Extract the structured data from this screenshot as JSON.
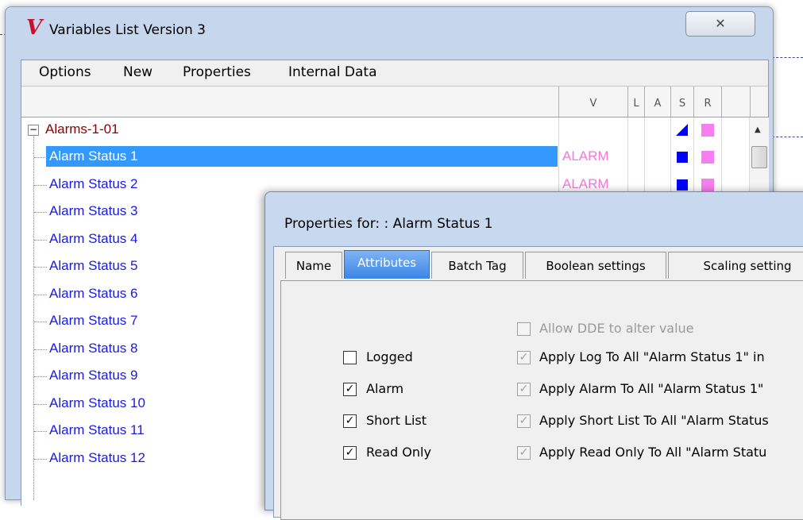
{
  "main_window": {
    "title": "Variables List Version 3",
    "logo_glyph": "𝑽",
    "close_glyph": "ꭗ",
    "menu": [
      "Options",
      "New",
      "Properties",
      "Internal Data"
    ],
    "columns": [
      "V",
      "L",
      "A",
      "S",
      "R"
    ]
  },
  "tree": {
    "group": {
      "toggle": "−",
      "label": "Alarms-1-01"
    },
    "items": [
      {
        "label": "Alarm Status 1",
        "value": "ALARM",
        "selected": true
      },
      {
        "label": "Alarm Status 2",
        "value": "ALARM"
      },
      {
        "label": "Alarm Status 3",
        "value": ""
      },
      {
        "label": "Alarm Status 4",
        "value": ""
      },
      {
        "label": "Alarm Status 5",
        "value": ""
      },
      {
        "label": "Alarm Status 6",
        "value": ""
      },
      {
        "label": "Alarm Status 7",
        "value": ""
      },
      {
        "label": "Alarm Status 8",
        "value": ""
      },
      {
        "label": "Alarm Status 9",
        "value": ""
      },
      {
        "label": "Alarm Status 10",
        "value": ""
      },
      {
        "label": "Alarm Status 11",
        "value": ""
      },
      {
        "label": "Alarm Status 12",
        "value": ""
      }
    ]
  },
  "properties_dialog": {
    "title": "Properties for: : Alarm Status 1",
    "tabs": [
      "Name",
      "Attributes",
      "Batch Tag",
      "Boolean settings",
      "Scaling setting"
    ],
    "active_tab": "Attributes",
    "allow_dde": {
      "label": "Allow DDE to alter value",
      "checked": false
    },
    "attributes": [
      {
        "label": "Logged",
        "checked": false,
        "apply_label": "Apply Log To All \"Alarm Status 1\" in",
        "apply_checked": true
      },
      {
        "label": "Alarm",
        "checked": true,
        "apply_label": "Apply Alarm To All \"Alarm Status 1\"",
        "apply_checked": true
      },
      {
        "label": "Short List",
        "checked": true,
        "apply_label": "Apply Short List To All \"Alarm Status",
        "apply_checked": true
      },
      {
        "label": "Read Only",
        "checked": true,
        "apply_label": "Apply Read Only To All \"Alarm Statu",
        "apply_checked": true
      }
    ],
    "check_glyph": "✓"
  },
  "colors": {
    "item_text": "#1a1ae6",
    "group_text": "#8b0000",
    "selected_bg": "#3399ff",
    "value_pink": "#f07ad8",
    "indicator_blue": "#0000ff",
    "indicator_pink": "#f67ef0"
  }
}
